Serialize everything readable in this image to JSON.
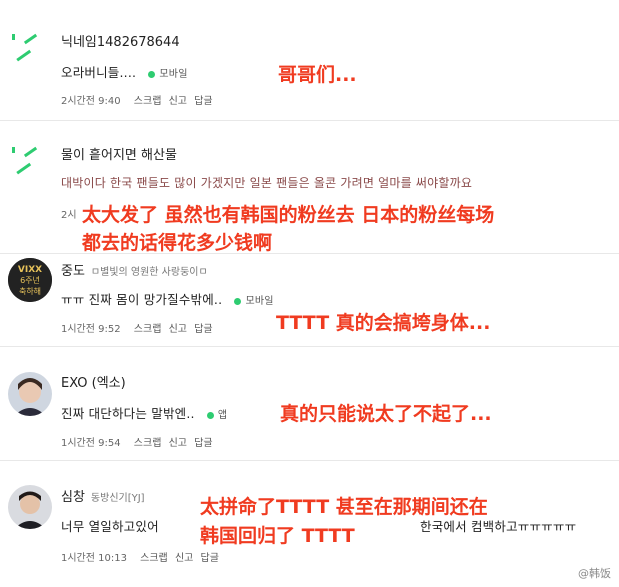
{
  "comments": [
    {
      "nickname": "닉네임1482678644",
      "sub": "",
      "text": "오라버니들....",
      "device": "모바일",
      "time": "2시간전 9:40",
      "scrap": "스크랩",
      "report": "신고",
      "reply": "답글",
      "annotation": [
        "哥哥们..."
      ]
    },
    {
      "nickname": "물이 흩어지면 해산물",
      "sub": "",
      "text": "대박이다 한국 팬들도 많이 가겠지만 일본 팬들은 올콘 가려면 얼마를 써야할까요",
      "device": "",
      "time": "2시",
      "scrap": "",
      "report": "",
      "reply": "",
      "annotation": [
        "太大发了 虽然也有韩国的粉丝去 日本的粉丝每场",
        "都去的话得花多少钱啊"
      ]
    },
    {
      "nickname": "중도",
      "sub": "ㅁ별빛의 영원한 사랑둥이ㅁ",
      "text": "ㅠㅠ 진짜 몸이 망가질수밖에..",
      "device": "모바일",
      "time": "1시간전 9:52",
      "scrap": "스크랩",
      "report": "신고",
      "reply": "답글",
      "annotation": [
        "TTTT 真的会搞垮身体..."
      ]
    },
    {
      "nickname": "EXO (엑소)",
      "sub": "",
      "text": "진짜 대단하다는 말밖엔..",
      "device": "앱",
      "time": "1시간전 9:54",
      "scrap": "스크랩",
      "report": "신고",
      "reply": "답글",
      "annotation": [
        "真的只能说太了不起了..."
      ]
    },
    {
      "nickname": "심창",
      "sub": "동방신기[YJ]",
      "text": "너무 열일하고있어",
      "text_tail": "한국에서 컴백하고ㅠㅠㅠㅠㅠ",
      "device": "",
      "time": "1시간전 10:13",
      "scrap": "스크랩",
      "report": "신고",
      "reply": "답글",
      "annotation": [
        "太拼命了TTTT 甚至在那期间还在",
        "韩国回归了 TTTT"
      ]
    }
  ],
  "watermark": "@韩饭",
  "colors": {
    "annotation": "#f03b20",
    "online_dot": "#2ecc71"
  }
}
